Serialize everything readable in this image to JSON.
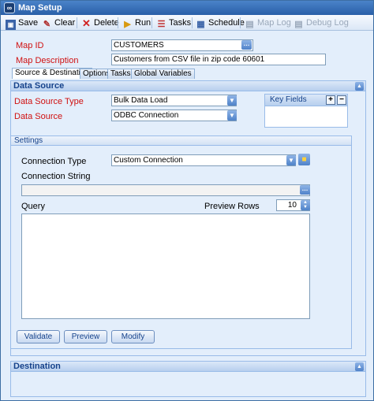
{
  "window": {
    "title": "Map Setup",
    "icon": "app-logo-icon"
  },
  "toolbar": {
    "save": "Save",
    "clear": "Clear",
    "delete": "Delete",
    "run": "Run",
    "tasks": "Tasks",
    "schedule": "Schedule",
    "map_log": "Map Log",
    "debug_log": "Debug Log"
  },
  "form": {
    "map_id_label": "Map ID",
    "map_id_value": "CUSTOMERS",
    "map_desc_label": "Map Description",
    "map_desc_value": "Customers from CSV file in zip code 60601"
  },
  "tabs": [
    "Source & Destination",
    "Options",
    "Tasks",
    "Global Variables"
  ],
  "data_source": {
    "header": "Data Source",
    "type_label": "Data Source Type",
    "type_value": "Bulk Data Load",
    "source_label": "Data Source",
    "source_value": "ODBC Connection",
    "key_fields_label": "Key Fields"
  },
  "settings": {
    "header": "Settings",
    "conn_type_label": "Connection Type",
    "conn_type_value": "Custom Connection",
    "conn_string_label": "Connection String",
    "conn_string_value": "",
    "query_label": "Query",
    "preview_rows_label": "Preview Rows",
    "preview_rows_value": "10",
    "validate": "Validate",
    "preview": "Preview",
    "modify": "Modify"
  },
  "destination": {
    "header": "Destination"
  },
  "colors": {
    "accent": "#15428b",
    "required_label": "#d01010",
    "panel": "#e3eefb"
  }
}
